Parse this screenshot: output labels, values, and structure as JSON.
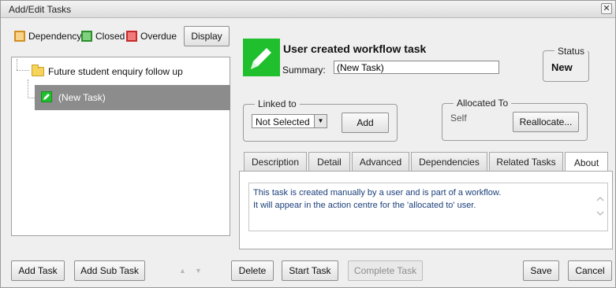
{
  "window": {
    "title": "Add/Edit Tasks",
    "close_glyph": "✕"
  },
  "legend": {
    "dependency": {
      "label": "Dependency",
      "fill": "#f8d38a",
      "border": "#d18f22"
    },
    "closed": {
      "label": "Closed",
      "fill": "#7fd07f",
      "border": "#2c8f2c"
    },
    "overdue": {
      "label": "Overdue",
      "fill": "#f17a7a",
      "border": "#c52b2b"
    },
    "display_button": "Display"
  },
  "tree": {
    "parent_label": "Future student enquiry follow up",
    "child_label": "(New Task)"
  },
  "task": {
    "heading": "User created workflow task",
    "summary_label": "Summary:",
    "summary_value": "(New Task)",
    "icon": "pencil-icon",
    "accent": "#1fbf2e"
  },
  "status": {
    "label": "Status",
    "value": "New"
  },
  "linked_to": {
    "label": "Linked to",
    "selected": "Not Selected",
    "add_button": "Add"
  },
  "allocated_to": {
    "label": "Allocated To",
    "value": "Self",
    "reallocate_button": "Reallocate..."
  },
  "tabs": [
    {
      "label": "Description"
    },
    {
      "label": "Detail"
    },
    {
      "label": "Advanced"
    },
    {
      "label": "Dependencies"
    },
    {
      "label": "Related Tasks"
    },
    {
      "label": "About"
    }
  ],
  "about": {
    "line1": "This task is created manually by a user and is part of a workflow.",
    "line2": "It will appear in the action centre for the 'allocated to' user."
  },
  "footer": {
    "add_task": "Add Task",
    "add_sub_task": "Add Sub Task",
    "move_up": "▲",
    "move_down": "▼",
    "delete": "Delete",
    "start_task": "Start Task",
    "complete_task": "Complete Task",
    "save": "Save",
    "cancel": "Cancel"
  }
}
